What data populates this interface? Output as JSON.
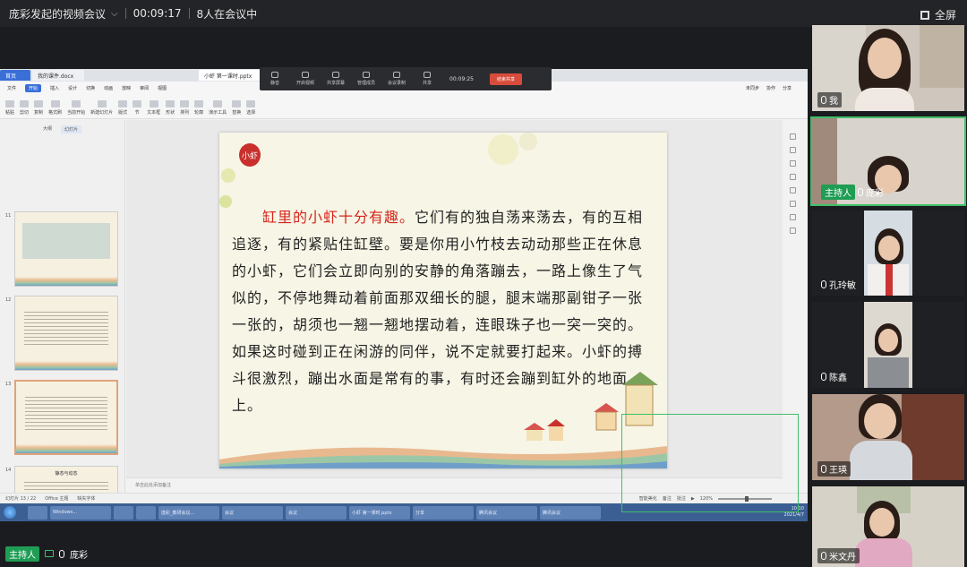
{
  "topbar": {
    "title": "庞彩发起的视频会议",
    "duration": "00:09:17",
    "participants": "8人在会议中",
    "fullscreen_label": "全屏"
  },
  "screen_share": {
    "tabs": [
      "首页",
      "我的课件.docx",
      "小虾 第一课时.pptx"
    ],
    "float_toolbar": {
      "items": [
        "静音",
        "开启视频",
        "共享屏幕",
        "管理成员",
        "会议录制",
        "共享"
      ],
      "time": "00:09:25",
      "stop_label": "结束共享"
    },
    "menu": {
      "items": [
        "文件",
        "开始",
        "插入",
        "设计",
        "切换",
        "动画",
        "放映",
        "审阅",
        "视图"
      ],
      "active": "开始",
      "right": [
        "未同步",
        "协作",
        "分享"
      ]
    },
    "ribbon": [
      "粘贴",
      "剪切",
      "复制",
      "格式刷",
      "当前开始",
      "新建幻灯片",
      "版式",
      "节",
      "文本框",
      "形状",
      "排列",
      "轮廓",
      "演示工具",
      "替换",
      "选择"
    ],
    "panel_tabs": [
      "大纲",
      "幻灯片"
    ],
    "thumbs": [
      {
        "num": "11"
      },
      {
        "num": "12"
      },
      {
        "num": "13"
      },
      {
        "num": "14",
        "title": "静态与动态"
      }
    ],
    "slide": {
      "seal": "小虾",
      "lead": "缸里的小虾十分有趣。",
      "text": "它们有的独自荡来荡去，有的互相追逐，有的紧贴住缸壁。要是你用小竹枝去动动那些正在休息的小虾，它们会立即向别的安静的角落蹦去，一路上像生了气似的，不停地舞动着前面那双细长的腿，腿末端那副钳子一张一张的，胡须也一翘一翘地摆动着，连眼珠子也一突一突的。如果这时碰到正在闲游的同伴，说不定就要打起来。小虾的搏斗很激烈，蹦出水面是常有的事，有时还会蹦到缸外的地面上。"
    },
    "notes_placeholder": "单击此处添加备注",
    "status": {
      "slide_index": "幻灯片 13 / 22",
      "theme": "Office 主题",
      "font_missing": "缺失字体",
      "smart": "智能美化",
      "notes_btn": "备注",
      "comments_btn": "批注",
      "zoom": "120%"
    },
    "taskbar": {
      "items": [
        "Windows...",
        "",
        "",
        "庞彩_教研会议...",
        "会议",
        "会议",
        "小虾 第一课时.pptx",
        "分享",
        "腾讯会议",
        "腾讯会议"
      ],
      "time": "10:10",
      "date": "2021/4/7"
    }
  },
  "participants": [
    {
      "name": "我",
      "host": false
    },
    {
      "name": "庞彩",
      "host": true,
      "host_label": "主持人"
    },
    {
      "name": "孔玲敏",
      "host": false
    },
    {
      "name": "陈鑫",
      "host": false
    },
    {
      "name": "王瑛",
      "host": false
    },
    {
      "name": "米文丹",
      "host": false
    }
  ],
  "speaker": {
    "host_label": "主持人",
    "name": "庞彩"
  },
  "colors": {
    "accent_green": "#1f9d55",
    "red_text": "#d6261c",
    "stop_red": "#d84c3c"
  }
}
